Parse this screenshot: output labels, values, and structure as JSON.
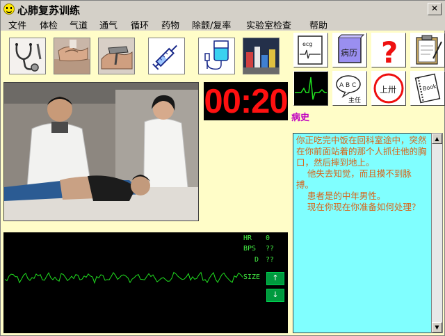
{
  "window": {
    "title": "心肺复苏训练"
  },
  "menu": [
    "文件",
    "体检",
    "气道",
    "通气",
    "循环",
    "药物",
    "除颤/复率",
    "实验室检查",
    "帮助"
  ],
  "tools": [
    {
      "name": "stethoscope-icon",
      "semantic": "stethoscope"
    },
    {
      "name": "chest-compression-icon",
      "semantic": "chest compression"
    },
    {
      "name": "airway-icon",
      "semantic": "airway"
    },
    {
      "name": "syringe-icon",
      "semantic": "syringe"
    },
    {
      "name": "iv-drip-icon",
      "semantic": "IV drip"
    },
    {
      "name": "lab-icon",
      "semantic": "lab equipment"
    }
  ],
  "right_tools": {
    "ecg_label": "ecg",
    "record_label": "病历",
    "help_mark": "?",
    "abc_label": "A B C",
    "abc_sub": "主任",
    "shang_label": "上卅",
    "book_label": "Book"
  },
  "timer": "00:20",
  "monitor": {
    "hr_label": "HR",
    "hr_value": "0",
    "bps_label": "BPS",
    "bps_value": "??",
    "d_label": "D",
    "d_value": "??",
    "size_label": "SIZE",
    "line_color": "#20e020"
  },
  "history": {
    "title": "病史",
    "text": "你正吃完中饭在回科室途中，突然在你前面站着的那个人抓住他的胸口，然后摔到地上。\n    他失去知觉，而且摸不到脉搏。\n    患者是的中年男性。\n    现在你现在你准备如何处理？"
  },
  "colors": {
    "timer": "#ff1010",
    "history_bg": "#80ffff",
    "history_text": "#d8641a",
    "title": "#c000c0"
  }
}
